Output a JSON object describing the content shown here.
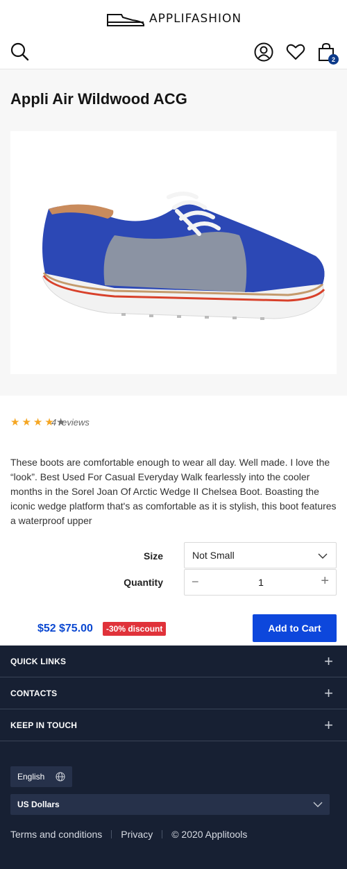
{
  "header": {
    "logo_text": "APPLIFASHION",
    "cart_count": "2"
  },
  "product": {
    "title": "Appli Air Wildwood ACG",
    "rating": 3.5,
    "reviews_label": "4 reviews",
    "description": "These boots are comfortable enough to wear all day. Well made. I love the “look”. Best Used For Casual Everyday Walk fearlessly into the cooler months in the Sorel Joan Of Arctic Wedge II Chelsea Boot. Boasting the iconic wedge platform that's as comfortable as it is stylish, this boot features a waterproof upper"
  },
  "options": {
    "size_label": "Size",
    "size_value": "Not Small",
    "quantity_label": "Quantity",
    "quantity_value": "1",
    "minus": "−",
    "plus": "+"
  },
  "pricing": {
    "price_new": "$52",
    "price_old": "$75.00",
    "discount": "-30% discount",
    "add_to_cart": "Add to Cart"
  },
  "footer": {
    "sections": [
      "QUICK LINKS",
      "CONTACTS",
      "KEEP IN TOUCH"
    ],
    "language": "English",
    "currency": "US Dollars",
    "links": [
      "Terms and conditions",
      "Privacy",
      "© 2020 Applitools"
    ]
  },
  "colors": {
    "primary": "#0d47dc",
    "discount": "#e0323a",
    "footer_bg": "#172033",
    "star": "#f5a623"
  }
}
